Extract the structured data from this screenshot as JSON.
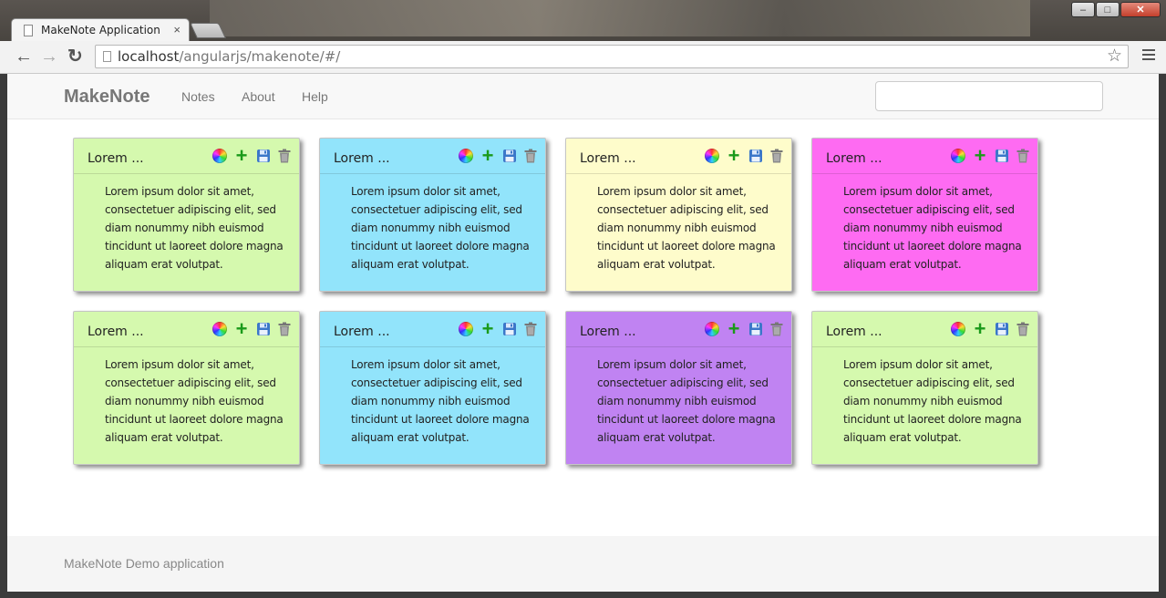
{
  "browser": {
    "tab_title": "MakeNote Application",
    "tab_close": "×",
    "url_host": "localhost",
    "url_path": "/angularjs/makenote/#/",
    "back": "←",
    "forward": "→",
    "reload": "↻",
    "star": "☆",
    "win_min": "–",
    "win_max": "□",
    "win_close": "✕"
  },
  "navbar": {
    "brand": "MakeNote",
    "links": [
      "Notes",
      "About",
      "Help"
    ],
    "search_value": ""
  },
  "notes": [
    {
      "title": "Lorem ...",
      "color": "#d5f9ae",
      "body": "Lorem ipsum dolor sit amet, consectetuer adipiscing elit, sed diam nonummy nibh euismod tincidunt ut laoreet dolore magna aliquam erat volutpat."
    },
    {
      "title": "Lorem ...",
      "color": "#92e4fb",
      "body": "Lorem ipsum dolor sit amet, consectetuer adipiscing elit, sed diam nonummy nibh euismod tincidunt ut laoreet dolore magna aliquam erat volutpat."
    },
    {
      "title": "Lorem ...",
      "color": "#fefccb",
      "body": "Lorem ipsum dolor sit amet, consectetuer adipiscing elit, sed diam nonummy nibh euismod tincidunt ut laoreet dolore magna aliquam erat volutpat."
    },
    {
      "title": "Lorem ...",
      "color": "#fe6bf2",
      "body": "Lorem ipsum dolor sit amet, consectetuer adipiscing elit, sed diam nonummy nibh euismod tincidunt ut laoreet dolore magna aliquam erat volutpat."
    },
    {
      "title": "Lorem ...",
      "color": "#d5f9ae",
      "body": "Lorem ipsum dolor sit amet, consectetuer adipiscing elit, sed diam nonummy nibh euismod tincidunt ut laoreet dolore magna aliquam erat volutpat."
    },
    {
      "title": "Lorem ...",
      "color": "#92e4fb",
      "body": "Lorem ipsum dolor sit amet, consectetuer adipiscing elit, sed diam nonummy nibh euismod tincidunt ut laoreet dolore magna aliquam erat volutpat."
    },
    {
      "title": "Lorem ...",
      "color": "#c083f2",
      "body": "Lorem ipsum dolor sit amet, consectetuer adipiscing elit, sed diam nonummy nibh euismod tincidunt ut laoreet dolore magna aliquam erat volutpat."
    },
    {
      "title": "Lorem ...",
      "color": "#d5f9ae",
      "body": "Lorem ipsum dolor sit amet, consectetuer adipiscing elit, sed diam nonummy nibh euismod tincidunt ut laoreet dolore magna aliquam erat volutpat."
    }
  ],
  "note_actions": {
    "color": "color-wheel-icon",
    "add": "+",
    "save": "save-icon",
    "delete": "trash-icon"
  },
  "footer": {
    "text": "MakeNote Demo application"
  }
}
